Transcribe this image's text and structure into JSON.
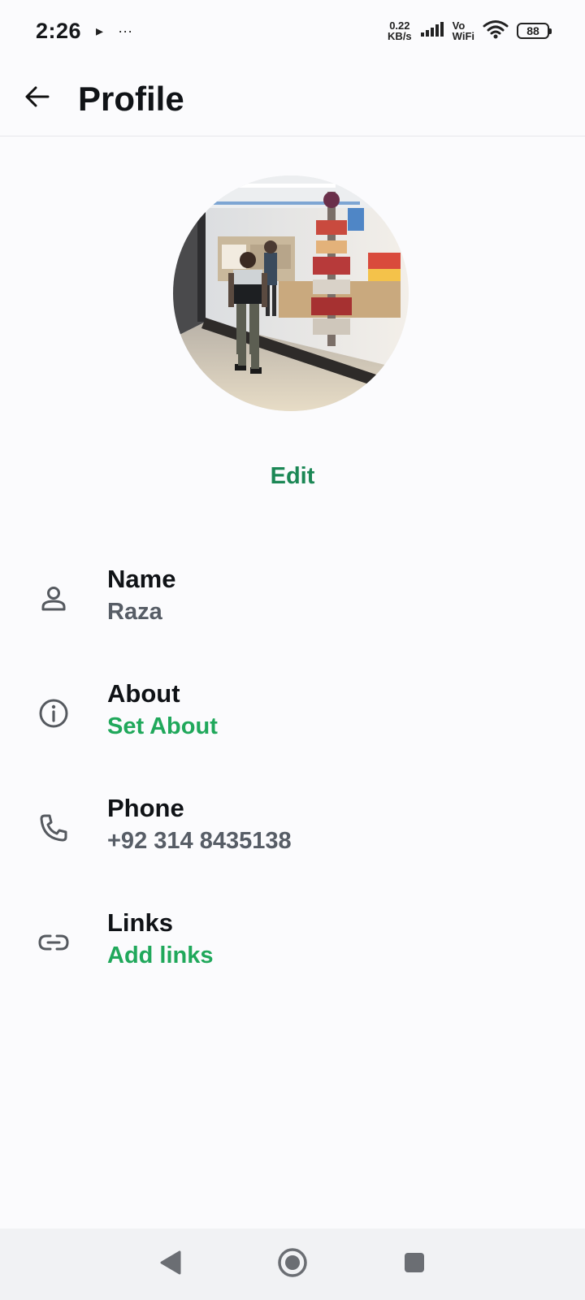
{
  "status_bar": {
    "time": "2:26",
    "notif_glyph": "▸",
    "more_glyph": "···",
    "net_speed_value": "0.22",
    "net_speed_unit": "KB/s",
    "vowifi_top": "Vo",
    "vowifi_bottom": "WiFi",
    "battery": "88"
  },
  "header": {
    "title": "Profile",
    "back_icon": "arrow-left-icon"
  },
  "profile": {
    "edit_label": "Edit"
  },
  "fields": [
    {
      "icon": "person-icon",
      "label": "Name",
      "value": "Raza",
      "is_link": false
    },
    {
      "icon": "info-icon",
      "label": "About",
      "value": "Set About",
      "is_link": true
    },
    {
      "icon": "phone-icon",
      "label": "Phone",
      "value": "+92 314 8435138",
      "is_link": false
    },
    {
      "icon": "link-icon",
      "label": "Links",
      "value": "Add links",
      "is_link": true
    }
  ],
  "colors": {
    "accent": "#1b8755",
    "link": "#20a85b",
    "secondary_text": "#575d66"
  },
  "nav": {
    "back_icon": "nav-back-icon",
    "home_icon": "nav-home-icon",
    "recents_icon": "nav-recents-icon"
  }
}
